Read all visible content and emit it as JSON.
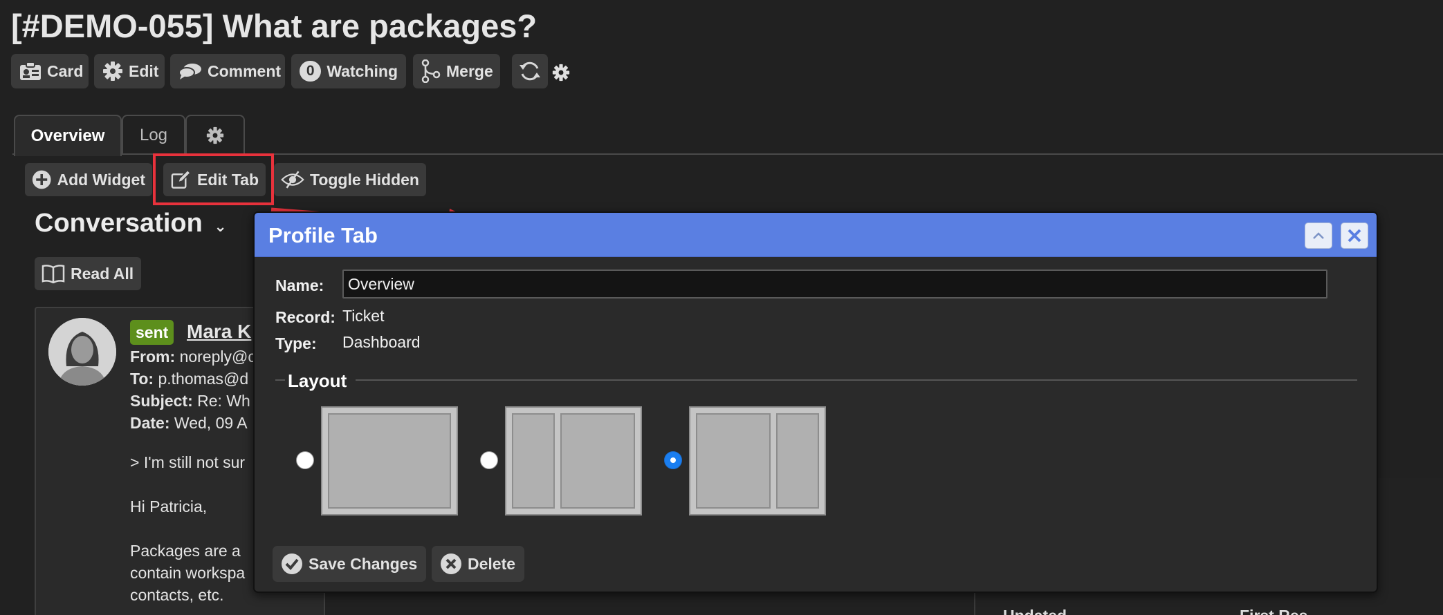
{
  "header": {
    "title": "[#DEMO-055] What are packages?",
    "toolbar": {
      "card_label": "Card",
      "edit_label": "Edit",
      "comment_label": "Comment",
      "watching_count": "0",
      "watching_label": "Watching",
      "merge_label": "Merge"
    }
  },
  "tabs": [
    {
      "label": "Overview",
      "active": true
    },
    {
      "label": "Log",
      "active": false
    },
    {
      "label": "",
      "icon": "gear-icon",
      "active": false
    }
  ],
  "subtoolbar": {
    "add_widget_label": "Add Widget",
    "edit_tab_label": "Edit Tab",
    "toggle_hidden_label": "Toggle Hidden"
  },
  "conversation": {
    "title": "Conversation",
    "read_all_label": "Read All",
    "message": {
      "status_badge": "sent",
      "sender": "Mara K",
      "from_label": "From:",
      "from_value": "noreply@c",
      "to_label": "To:",
      "to_value": "p.thomas@d",
      "subject_label": "Subject:",
      "subject_value": "Re: Wh",
      "date_label": "Date:",
      "date_value": "Wed, 09 A",
      "body_lines": [
        "> I'm still not sur",
        "Hi Patricia,",
        "Packages are a",
        "contain workspa",
        "contacts, etc."
      ]
    }
  },
  "background_right": {
    "fragment_left": "Updated",
    "fragment_right": "First Res"
  },
  "modal": {
    "title": "Profile Tab",
    "name_label": "Name:",
    "name_value": "Overview",
    "record_label": "Record:",
    "record_value": "Ticket",
    "type_label": "Type:",
    "type_value": "Dashboard",
    "layout_legend": "Layout",
    "layout_options": [
      {
        "name": "single-column",
        "checked": false
      },
      {
        "name": "narrow-left-wide-right",
        "checked": false
      },
      {
        "name": "wide-left-narrow-right",
        "checked": true
      }
    ],
    "save_label": "Save Changes",
    "delete_label": "Delete"
  },
  "colors": {
    "background": "#212121",
    "modal_header": "#5a7fe2",
    "highlight_box": "#e8323c",
    "sent_badge": "#5d8f1c",
    "radio_checked": "#1a7ef0"
  }
}
